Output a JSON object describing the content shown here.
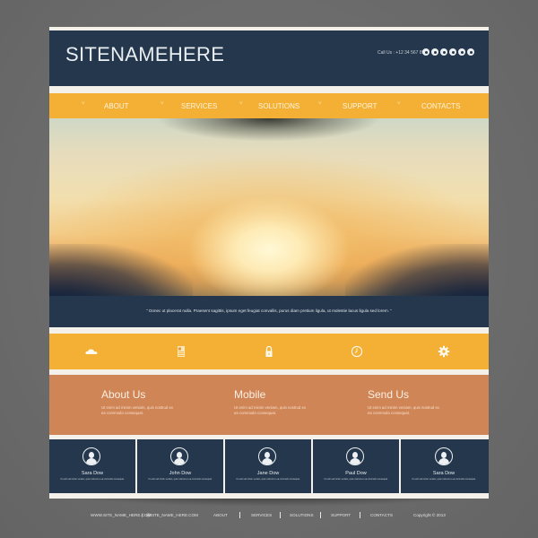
{
  "header": {
    "site_name": "SITENAMEHERE",
    "call_us": "Call Us : +12 34 567 89",
    "social_icons": [
      "drop-icon",
      "globe-icon",
      "square-icon",
      "share-icon",
      "at-icon",
      "chat-icon"
    ]
  },
  "nav": {
    "items": [
      {
        "label": "ABOUT"
      },
      {
        "label": "SERVICES"
      },
      {
        "label": "SOLUTIONS"
      },
      {
        "label": "SUPPORT"
      },
      {
        "label": "CONTACTS"
      }
    ],
    "chevron": "˅"
  },
  "quote": {
    "text": "” Donec ut placerat nulla. Praesent sagittis, ipsum eget feugiat convallis, purus diam pretium ligula, ut molestie lacus ligula sed lorem. ”"
  },
  "features": {
    "icons": [
      "cloud-icon",
      "document-icon",
      "lock-icon",
      "clock-icon",
      "gear-icon"
    ]
  },
  "info": {
    "columns": [
      {
        "title": "About Us",
        "text": "Ut enim ad minim veniam, quis nostrud ex ea commodo consequat."
      },
      {
        "title": "Mobile",
        "text": "Ut enim ad minim veniam, quis nostrud ex ea commodo consequat."
      },
      {
        "title": "Send Us",
        "text": "Ut enim ad minim veniam, quis nostrud ex ea commodo consequat."
      }
    ]
  },
  "team": {
    "members": [
      {
        "name": "Sara Dow",
        "text": "Ut enim ad minim veniam, quis nostrud ex ea commodo consequat."
      },
      {
        "name": "John Dow",
        "text": "Ut enim ad minim veniam, quis nostrud ex ea commodo consequat."
      },
      {
        "name": "Jane Dow",
        "text": "Ut enim ad minim veniam, quis nostrud ex ea commodo consequat."
      },
      {
        "name": "Paul Dow",
        "text": "Ut enim ad minim veniam, quis nostrud ex ea commodo consequat."
      },
      {
        "name": "Sara Dow",
        "text": "Ut enim ad minim veniam, quis nostrud ex ea commodo consequat."
      }
    ]
  },
  "footer": {
    "website": "WWW.SITE_NAME_HERE.COM",
    "divider": "|",
    "handle": "@SITE_NAME_HERE.COM",
    "links": [
      {
        "label": "ABOUT"
      },
      {
        "label": "SERVICES"
      },
      {
        "label": "SOLUTIONS"
      },
      {
        "label": "SUPPORT"
      },
      {
        "label": "CONTACTS"
      }
    ],
    "copyright": "Copyright © 2013"
  },
  "colors": {
    "navy": "#25374c",
    "amber": "#f4b034",
    "terracotta": "#cf8556",
    "background": "#6c6c6c"
  }
}
